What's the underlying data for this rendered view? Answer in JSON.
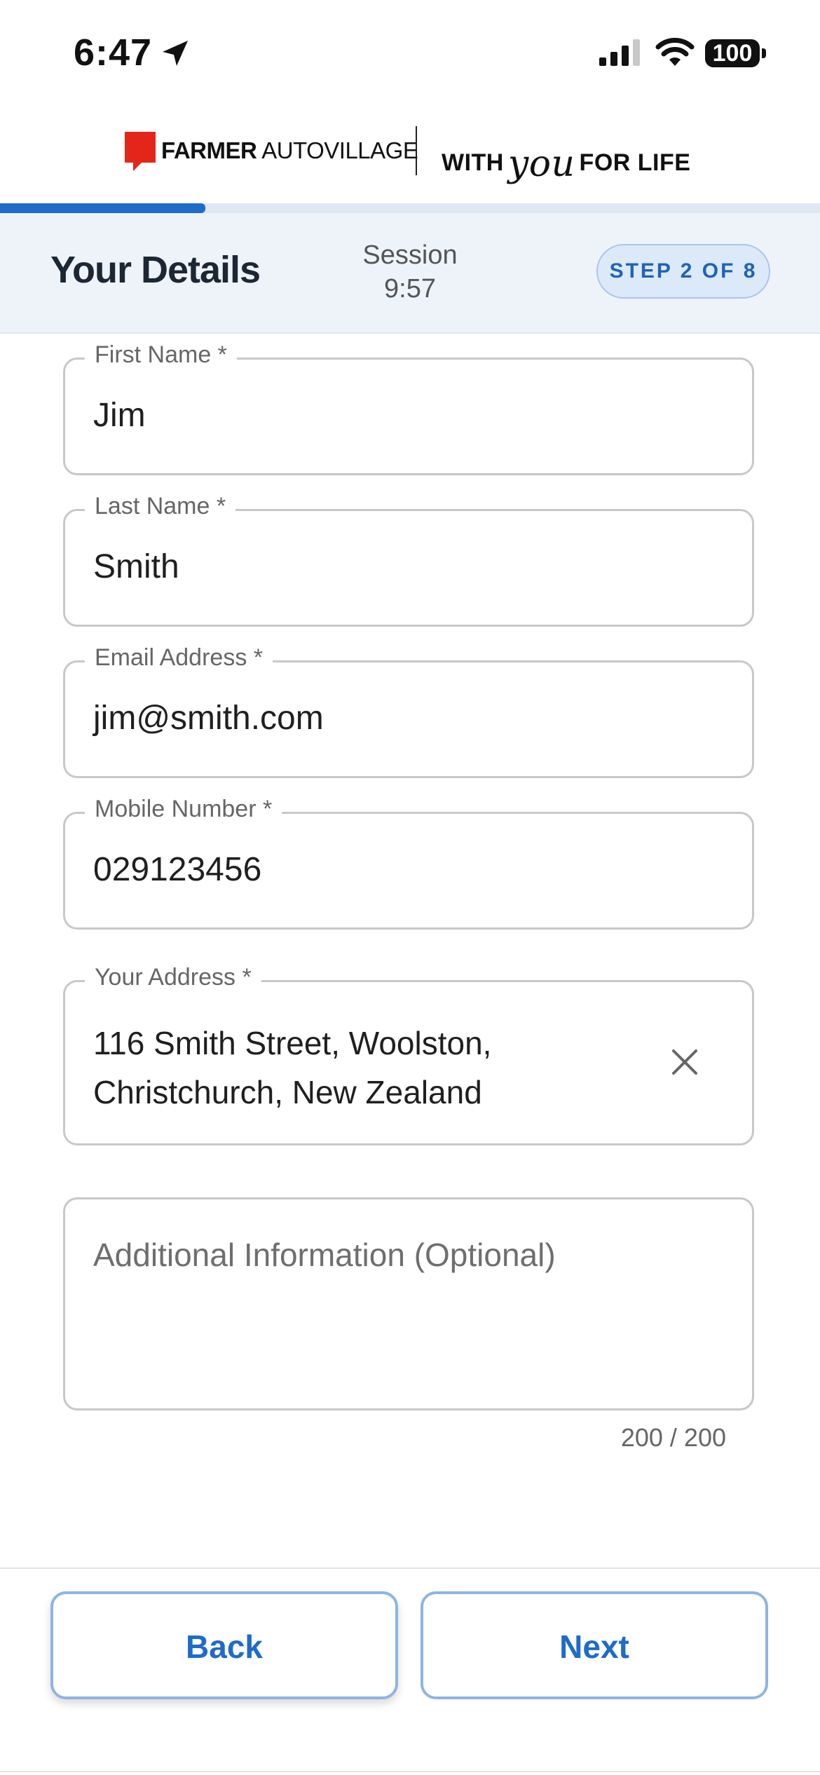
{
  "status_bar": {
    "time": "6:47",
    "battery": "100"
  },
  "brand": {
    "name_bold": "FARMER",
    "name_rest": " AUTOVILLAGE",
    "tagline_start": "WITH",
    "tagline_script": "you",
    "tagline_end": "FOR LIFE",
    "accent_color": "#e4261a"
  },
  "progress": {
    "fraction": 0.25,
    "color": "#1f6bc9"
  },
  "step_header": {
    "title": "Your Details",
    "session_label": "Session",
    "session_time": "9:57",
    "step_badge": "STEP 2 OF 8"
  },
  "form": {
    "first_name": {
      "label": "First Name *",
      "value": "Jim"
    },
    "last_name": {
      "label": "Last Name *",
      "value": "Smith"
    },
    "email": {
      "label": "Email Address *",
      "value": "jim@smith.com"
    },
    "mobile": {
      "label": "Mobile Number *",
      "value": "029123456"
    },
    "address": {
      "label": "Your Address *",
      "line1": "116 Smith Street, Woolston,",
      "line2": "Christchurch, New Zealand"
    },
    "additional": {
      "placeholder": "Additional Information (Optional)",
      "counter": "200 / 200"
    }
  },
  "buttons": {
    "back": "Back",
    "next": "Next"
  },
  "icons": [
    "location-arrow-icon",
    "signal-icon",
    "wifi-icon",
    "battery-icon",
    "close-icon"
  ]
}
